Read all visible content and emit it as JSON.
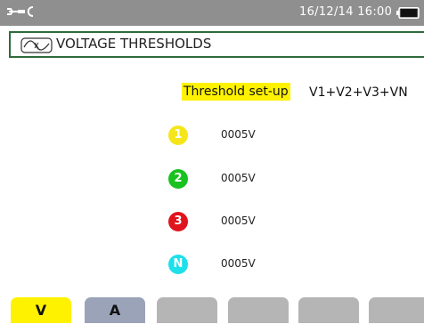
{
  "status_bar": {
    "datetime": "16/12/14  16:00",
    "icons": {
      "tools": "wrench-plug-icon",
      "battery": "battery-icon"
    },
    "background": "#8f8f8f"
  },
  "title_bar": {
    "icon": "voltage-threshold-icon",
    "title": "VOLTAGE THRESHOLDS",
    "border_color": "#2f6b3c"
  },
  "setup": {
    "label": "Threshold set-up",
    "value": "V1+V2+V3+VN",
    "highlight_color": "#fff200"
  },
  "phases": [
    {
      "badge": "1",
      "color": "#f5e61b",
      "value": "0005V"
    },
    {
      "badge": "2",
      "color": "#19c21e",
      "value": "0005V"
    },
    {
      "badge": "3",
      "color": "#e0141c",
      "value": "0005V"
    },
    {
      "badge": "N",
      "color": "#1ee0ea",
      "value": "0005V"
    }
  ],
  "tabs": [
    {
      "label": "V",
      "active": true
    },
    {
      "label": "A",
      "active": false
    },
    {
      "label": "",
      "active": false
    },
    {
      "label": "",
      "active": false
    },
    {
      "label": "",
      "active": false
    },
    {
      "label": "",
      "active": false
    },
    {
      "label": "",
      "active": false
    }
  ]
}
